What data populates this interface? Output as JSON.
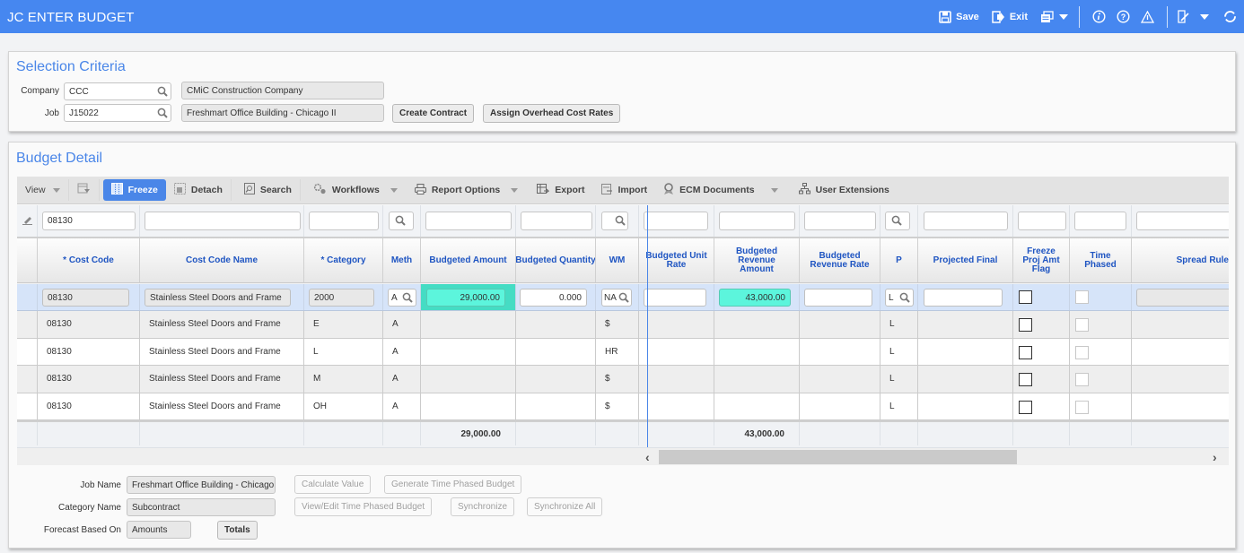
{
  "app": {
    "title": "JC ENTER BUDGET",
    "actions": {
      "save": "Save",
      "exit": "Exit"
    }
  },
  "selection": {
    "title": "Selection Criteria",
    "company_label": "Company",
    "company_value": "CCC",
    "company_name": "CMiC Construction Company",
    "job_label": "Job",
    "job_value": "J15022",
    "job_name": "Freshmart Office Building - Chicago II",
    "create_contract": "Create Contract",
    "assign_overhead": "Assign Overhead Cost Rates"
  },
  "detail": {
    "title": "Budget Detail",
    "toolbar": {
      "view": "View",
      "freeze": "Freeze",
      "detach": "Detach",
      "search": "Search",
      "workflows": "Workflows",
      "report_options": "Report Options",
      "export": "Export",
      "import": "Import",
      "ecm_documents": "ECM Documents",
      "user_extensions": "User Extensions"
    },
    "filter": {
      "cost_code": "08130"
    },
    "columns": {
      "cost_code": "* Cost Code",
      "cost_code_name": "Cost Code Name",
      "category": "* Category",
      "meth": "Meth",
      "budgeted_amount": "Budgeted Amount",
      "budgeted_quantity": "Budgeted Quantity",
      "wm": "WM",
      "budgeted_unit_rate": "Budgeted Unit Rate",
      "budgeted_revenue_amount": "Budgeted Revenue Amount",
      "budgeted_revenue_rate": "Budgeted Revenue Rate",
      "p": "P",
      "projected_final": "Projected Final",
      "freeze_proj_amt_flag": "Freeze Proj Amt Flag",
      "time_phased": "Time Phased",
      "spread_rule": "Spread Rule"
    },
    "edit_row": {
      "cost_code": "08130",
      "cost_code_name": "Stainless Steel Doors and Frame",
      "category": "2000",
      "meth": "A",
      "budgeted_amount": "29,000.00",
      "budgeted_quantity": "0.000",
      "wm": "NA",
      "budgeted_unit_rate": "",
      "budgeted_revenue_amount": "43,000.00",
      "budgeted_revenue_rate": "",
      "p": "L",
      "projected_final": "",
      "freeze_proj_amt_flag": false,
      "time_phased": false
    },
    "rows": [
      {
        "cost_code": "08130",
        "cost_code_name": "Stainless Steel Doors and Frame",
        "category": "E",
        "meth": "A",
        "wm": "$",
        "p": "L"
      },
      {
        "cost_code": "08130",
        "cost_code_name": "Stainless Steel Doors and Frame",
        "category": "L",
        "meth": "A",
        "wm": "HR",
        "p": "L"
      },
      {
        "cost_code": "08130",
        "cost_code_name": "Stainless Steel Doors and Frame",
        "category": "M",
        "meth": "A",
        "wm": "$",
        "p": "L"
      },
      {
        "cost_code": "08130",
        "cost_code_name": "Stainless Steel Doors and Frame",
        "category": "OH",
        "meth": "A",
        "wm": "$",
        "p": "L"
      }
    ],
    "totals": {
      "budgeted_amount": "29,000.00",
      "budgeted_revenue_amount": "43,000.00"
    }
  },
  "footer": {
    "job_name_label": "Job Name",
    "job_name_value": "Freshmart Office Building - Chicago II",
    "category_name_label": "Category Name",
    "category_name_value": "Subcontract",
    "forecast_label": "Forecast Based On",
    "forecast_value": "Amounts",
    "totals_btn": "Totals",
    "calculate_value": "Calculate Value",
    "generate_tp_budget": "Generate Time Phased Budget",
    "view_edit_tp_budget": "View/Edit Time Phased Budget",
    "synchronize": "Synchronize",
    "synchronize_all": "Synchronize All"
  }
}
